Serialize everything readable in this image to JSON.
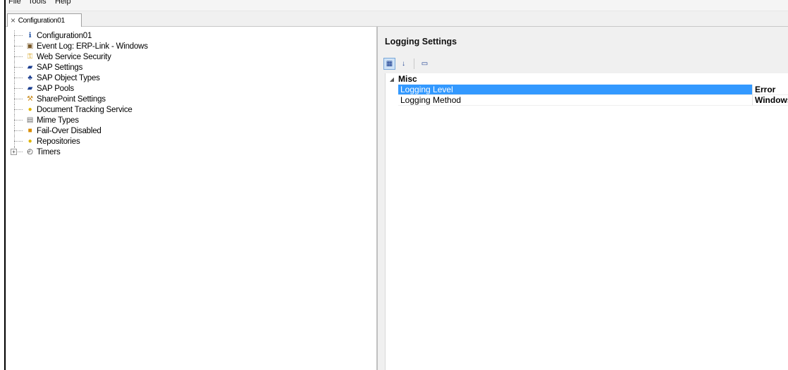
{
  "menu": [
    "File",
    "Tools",
    "Help"
  ],
  "tab": {
    "label": "Configuration01",
    "close_glyph": "×"
  },
  "tree": [
    {
      "label": "Configuration01",
      "icon": "info-icon",
      "glyph": "ℹ",
      "color": "#1e4fa3"
    },
    {
      "label": "Event Log: ERP-Link - Windows",
      "icon": "event-log-icon",
      "glyph": "▣",
      "color": "#7a5a2a"
    },
    {
      "label": "Web Service Security",
      "icon": "keys-icon",
      "glyph": "⚿",
      "color": "#d4a017"
    },
    {
      "label": "SAP Settings",
      "icon": "sap-settings-icon",
      "glyph": "▰",
      "color": "#1a3d8f"
    },
    {
      "label": "SAP Object Types",
      "icon": "object-types-icon",
      "glyph": "♣",
      "color": "#1a3d8f"
    },
    {
      "label": "SAP Pools",
      "icon": "sap-pools-icon",
      "glyph": "▰",
      "color": "#1a3d8f"
    },
    {
      "label": "SharePoint Settings",
      "icon": "sharepoint-icon",
      "glyph": "⚒",
      "color": "#c98a1b"
    },
    {
      "label": "Document Tracking Service",
      "icon": "service-icon",
      "glyph": "●",
      "color": "#e0b400"
    },
    {
      "label": "Mime Types",
      "icon": "document-icon",
      "glyph": "▤",
      "color": "#666666"
    },
    {
      "label": "Fail-Over Disabled",
      "icon": "failover-icon",
      "glyph": "■",
      "color": "#d98c00"
    },
    {
      "label": "Repositories",
      "icon": "repository-icon",
      "glyph": "●",
      "color": "#e0b400"
    },
    {
      "label": "Timers",
      "icon": "clock-icon",
      "glyph": "◴",
      "color": "#222222",
      "expander": "+"
    }
  ],
  "right": {
    "title": "Logging Settings",
    "toolbar": [
      {
        "name": "categorized-icon",
        "glyph": "▦",
        "active": true
      },
      {
        "name": "alphabetical-icon",
        "glyph": "↓",
        "active": false
      },
      {
        "name": "property-pages-icon",
        "glyph": "▭",
        "active": false
      }
    ],
    "category": "Misc",
    "properties": [
      {
        "name": "Logging Level",
        "value": "Error",
        "selected": true
      },
      {
        "name": "Logging Method",
        "value": "Windows",
        "selected": false
      }
    ]
  },
  "colors": {
    "selection": "#3399ff",
    "accent_blue": "#1a3d8f"
  }
}
